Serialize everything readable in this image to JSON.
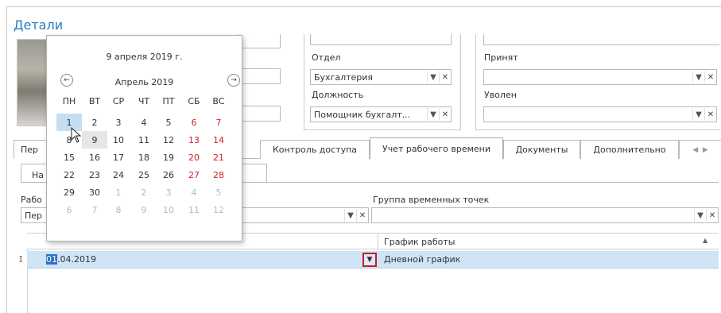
{
  "title": "Детали",
  "fields": {
    "dept_label": "Отдел",
    "dept_value": "Бухгалтерия",
    "position_label": "Должность",
    "position_value": "Помощник бухгалт...",
    "hired_label": "Принят",
    "hired_value": "",
    "fired_label": "Уволен",
    "fired_value": ""
  },
  "tabs": [
    {
      "label": "Пер"
    },
    {
      "label": "Контроль доступа"
    },
    {
      "label": "Учет рабочего времени"
    },
    {
      "label": "Документы"
    },
    {
      "label": "Дополнительно"
    }
  ],
  "subtab": {
    "label": "На"
  },
  "work_label": "Рабо",
  "work_value": "Пер",
  "time_group_label": "Группа временных точек",
  "time_group_value": "",
  "grid": {
    "col_schedule": "График работы",
    "row_indicator": "I",
    "row_date_hl": "01",
    "row_date_rest": ".04.2019",
    "row_schedule": "Дневной график"
  },
  "calendar": {
    "today_label": "9 апреля 2019 г.",
    "month_label": "Апрель 2019",
    "weekdays": [
      "ПН",
      "ВТ",
      "СР",
      "ЧТ",
      "ПТ",
      "СБ",
      "ВС"
    ],
    "weeks": [
      [
        "1",
        "2",
        "3",
        "4",
        "5",
        "6",
        "7"
      ],
      [
        "8",
        "9",
        "10",
        "11",
        "12",
        "13",
        "14"
      ],
      [
        "15",
        "16",
        "17",
        "18",
        "19",
        "20",
        "21"
      ],
      [
        "22",
        "23",
        "24",
        "25",
        "26",
        "27",
        "28"
      ],
      [
        "29",
        "30",
        "1",
        "2",
        "3",
        "4",
        "5"
      ],
      [
        "6",
        "7",
        "8",
        "9",
        "10",
        "11",
        "12"
      ]
    ],
    "weekend_color": "#d0202a",
    "selected_color": "#c6def2"
  },
  "icons": {
    "prev": "arrow-left-circle",
    "next": "arrow-right-circle",
    "dropdown": "chevron-down",
    "clear": "x"
  }
}
